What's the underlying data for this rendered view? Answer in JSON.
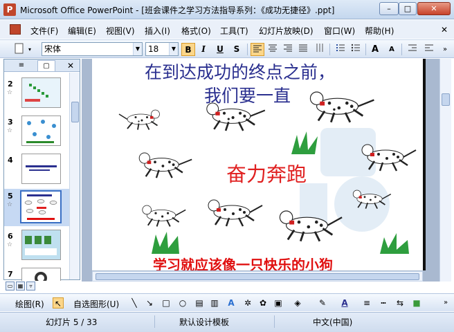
{
  "window": {
    "title": "Microsoft Office PowerPoint - [班会课件之学习方法指导系列：《成功无捷径》.ppt]",
    "app_icon_letter": "P",
    "minimize": "–",
    "maximize": "□",
    "close": "✕"
  },
  "menu": {
    "items": [
      "文件(F)",
      "编辑(E)",
      "视图(V)",
      "插入(I)",
      "格式(O)",
      "工具(T)",
      "幻灯片放映(D)",
      "窗口(W)",
      "帮助(H)"
    ],
    "close_doc": "✕"
  },
  "toolbar": {
    "font_name": "宋体",
    "font_size": "18",
    "bold": "B",
    "italic": "I",
    "underline": "U",
    "shadow": "S",
    "increase_font": "A",
    "decrease_font": "A",
    "overflow": "»"
  },
  "slide_pane": {
    "tab_outline": "≡",
    "tab_slides": "▢",
    "close": "✕",
    "thumbnails": [
      {
        "num": "2",
        "star": "☆"
      },
      {
        "num": "3",
        "star": "☆"
      },
      {
        "num": "4",
        "star": ""
      },
      {
        "num": "5",
        "star": "☆",
        "selected": true
      },
      {
        "num": "6",
        "star": "☆"
      },
      {
        "num": "7",
        "star": ""
      }
    ]
  },
  "slide": {
    "line1": "在到达成功的终点之前，",
    "line2": "我们要一直",
    "middle": "奋力奔跑",
    "bottom": "学习就应该像一只快乐的小狗"
  },
  "drawing_toolbar": {
    "draw_label": "绘图(R)",
    "autoshapes_label": "自选图形(U)"
  },
  "status": {
    "slide_info": "幻灯片 5 / 33",
    "template": "默认设计模板",
    "language": "中文(中国)"
  },
  "colors": {
    "slide_title_blue": "#2a2f8f",
    "slide_red": "#e02020",
    "dog_collar": "#d02020"
  }
}
